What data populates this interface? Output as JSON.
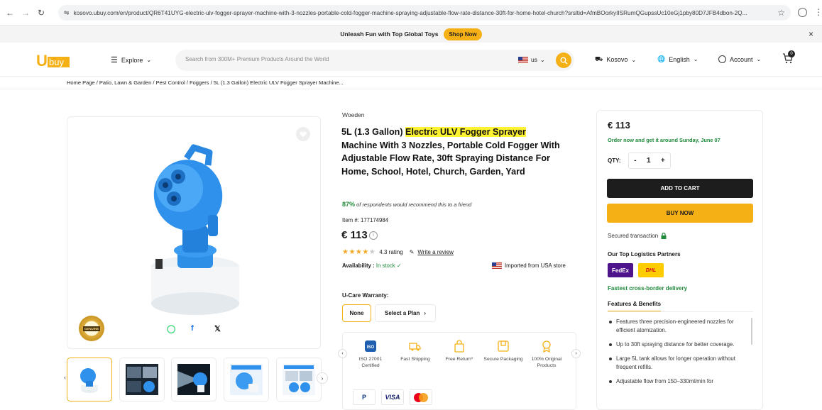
{
  "browser": {
    "url": "kosovo.ubuy.com/en/product/QR6T41UYG-electric-ulv-fogger-sprayer-machine-with-3-nozzles-portable-cold-fogger-machine-spraying-adjustable-flow-rate-distance-30ft-for-home-hotel-church?srsltid=AfmBOorkyIISRumQGupssUc10eGj1pby80D7JFB4dbon-2Q..."
  },
  "promo": {
    "text": "Unleash Fun with Top Global Toys",
    "cta": "Shop Now",
    "close": "×"
  },
  "header": {
    "logo_text": "Ubuy",
    "explore": "Explore",
    "search_placeholder": "Search from 300M+ Premium Products Around the World",
    "locale": "us",
    "country": "Kosovo",
    "language": "English",
    "account": "Account",
    "cart_count": "0"
  },
  "breadcrumb": "Home Page / Patio, Lawn & Garden / Pest Control / Foggers / 5L (1.3 Gallon) Electric ULV Fogger Sprayer Machine...",
  "product": {
    "brand": "Woeden",
    "title_pre": "5L (1.3 Gallon) ",
    "title_highlight": "Electric ULV Fogger Sprayer",
    "title_post": " Machine With 3 Nozzles, Portable Cold Fogger With Adjustable Flow Rate, 30ft Spraying Distance For Home, School, Hotel, Church, Garden, Yard",
    "recommend_pct": "87%",
    "recommend_text": " of respondents would recommend this to a friend",
    "item_number": "Item #: 177174984",
    "price": "€ 113",
    "rating": 4.3,
    "rating_text": "4.3 rating",
    "write_review": "Write a review",
    "availability_label": "Availability : ",
    "availability_value": "In stock ✓",
    "imported": "Imported from USA store",
    "warranty_label": "U-Care Warranty:",
    "warranty_none": "None",
    "warranty_plan": "Select a Plan"
  },
  "badges": {
    "genuine": "GENUINE"
  },
  "features_strip": [
    {
      "label": "ISO 27001 Certified",
      "icon": "iso-icon"
    },
    {
      "label": "Fast Shipping",
      "icon": "truck-icon"
    },
    {
      "label": "Free Return*",
      "icon": "bag-icon"
    },
    {
      "label": "Secure Packaging",
      "icon": "package-icon"
    },
    {
      "label": "100% Original Products",
      "icon": "award-icon"
    }
  ],
  "payments": [
    "P",
    "VISA",
    "mastercard"
  ],
  "buy_box": {
    "price": "€ 113",
    "delivery": "Order now and get it around Sunday, June 07",
    "qty_label": "QTY:",
    "qty_value": "1",
    "add_to_cart": "ADD TO CART",
    "buy_now": "BUY NOW",
    "secured": "Secured transaction",
    "partners_label": "Our Top Logistics Partners",
    "fedex": "FedEx",
    "dhl": "DHL",
    "fastest": "Fastest cross-border delivery",
    "features_tab": "Features & Benefits",
    "benefits": [
      "Features three precision-engineered nozzles for efficient atomization.",
      "Up to 30ft spraying distance for better coverage.",
      "Large 5L tank allows for longer operation without frequent refills.",
      "Adjustable flow from 150–330ml/min for"
    ]
  },
  "colors": {
    "accent": "#f5b016",
    "success": "#1f8a3b",
    "highlight": "#fff233",
    "dark_button": "#1d1d1d"
  }
}
